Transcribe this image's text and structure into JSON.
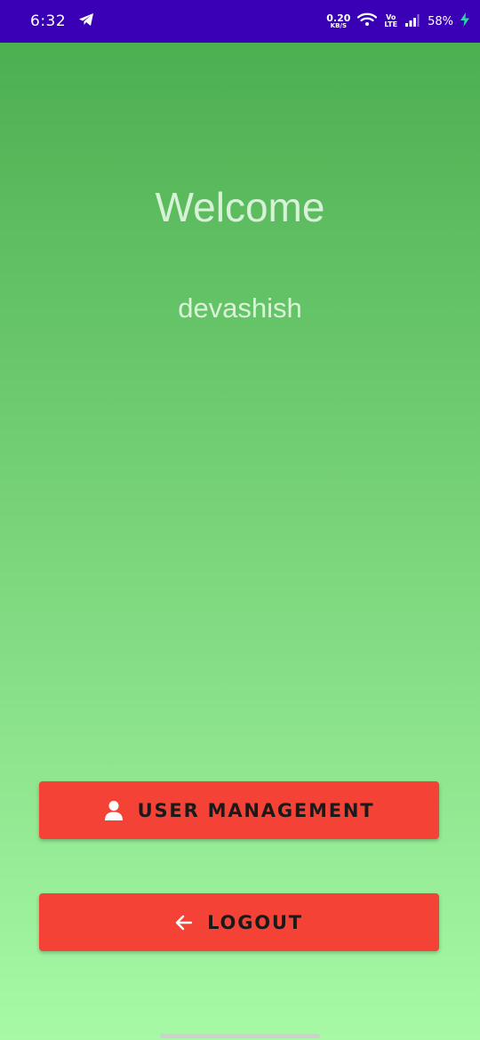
{
  "status_bar": {
    "time": "6:32",
    "net_speed_value": "0.20",
    "net_speed_unit": "KB/S",
    "volte_top": "Vo",
    "volte_bottom": "LTE",
    "battery": "58%",
    "icons": [
      "telegram-icon",
      "wifi-icon",
      "signal-icon",
      "charging-icon"
    ]
  },
  "main": {
    "welcome": "Welcome",
    "username": "devashish"
  },
  "buttons": {
    "user_management": "USER MANAGEMENT",
    "logout": "LOGOUT"
  },
  "colors": {
    "status_bar": "#3a00b5",
    "gradient_top": "#4caf50",
    "gradient_bottom": "#a7f9a6",
    "button": "#f44336"
  }
}
